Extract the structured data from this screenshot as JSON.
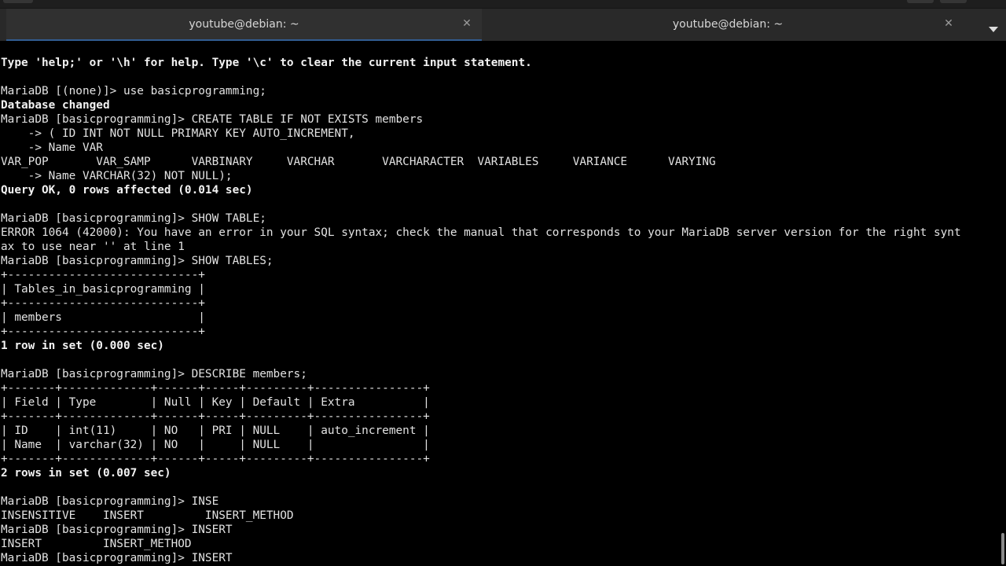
{
  "tabs": [
    {
      "title": "youtube@debian: ~",
      "active": true
    },
    {
      "title": "youtube@debian: ~",
      "active": false
    }
  ],
  "terminal": {
    "lines": [
      {
        "text": "Type 'help;' or '\\h' for help. Type '\\c' to clear the current input statement.",
        "bold": true
      },
      {
        "text": "",
        "bold": false
      },
      {
        "text": "MariaDB [(none)]> use basicprogramming;",
        "bold": false
      },
      {
        "text": "Database changed",
        "bold": true
      },
      {
        "text": "MariaDB [basicprogramming]> CREATE TABLE IF NOT EXISTS members",
        "bold": false
      },
      {
        "text": "    -> ( ID INT NOT NULL PRIMARY KEY AUTO_INCREMENT,",
        "bold": false
      },
      {
        "text": "    -> Name VAR",
        "bold": false
      },
      {
        "text": "VAR_POP       VAR_SAMP      VARBINARY     VARCHAR       VARCHARACTER  VARIABLES     VARIANCE      VARYING",
        "bold": false
      },
      {
        "text": "    -> Name VARCHAR(32) NOT NULL);",
        "bold": false
      },
      {
        "text": "Query OK, 0 rows affected (0.014 sec)",
        "bold": true
      },
      {
        "text": "",
        "bold": false
      },
      {
        "text": "MariaDB [basicprogramming]> SHOW TABLE;",
        "bold": false
      },
      {
        "text": "ERROR 1064 (42000): You have an error in your SQL syntax; check the manual that corresponds to your MariaDB server version for the right synt",
        "bold": false
      },
      {
        "text": "ax to use near '' at line 1",
        "bold": false
      },
      {
        "text": "MariaDB [basicprogramming]> SHOW TABLES;",
        "bold": false
      },
      {
        "text": "+----------------------------+",
        "bold": false
      },
      {
        "text": "| Tables_in_basicprogramming |",
        "bold": false
      },
      {
        "text": "+----------------------------+",
        "bold": false
      },
      {
        "text": "| members                    |",
        "bold": false
      },
      {
        "text": "+----------------------------+",
        "bold": false
      },
      {
        "text": "1 row in set (0.000 sec)",
        "bold": true
      },
      {
        "text": "",
        "bold": false
      },
      {
        "text": "MariaDB [basicprogramming]> DESCRIBE members;",
        "bold": false
      },
      {
        "text": "+-------+-------------+------+-----+---------+----------------+",
        "bold": false
      },
      {
        "text": "| Field | Type        | Null | Key | Default | Extra          |",
        "bold": false
      },
      {
        "text": "+-------+-------------+------+-----+---------+----------------+",
        "bold": false
      },
      {
        "text": "| ID    | int(11)     | NO   | PRI | NULL    | auto_increment |",
        "bold": false
      },
      {
        "text": "| Name  | varchar(32) | NO   |     | NULL    |                |",
        "bold": false
      },
      {
        "text": "+-------+-------------+------+-----+---------+----------------+",
        "bold": false
      },
      {
        "text": "2 rows in set (0.007 sec)",
        "bold": true
      },
      {
        "text": "",
        "bold": false
      },
      {
        "text": "MariaDB [basicprogramming]> INSE",
        "bold": false
      },
      {
        "text": "INSENSITIVE    INSERT         INSERT_METHOD",
        "bold": false
      },
      {
        "text": "MariaDB [basicprogramming]> INSERT",
        "bold": false
      },
      {
        "text": "INSERT         INSERT_METHOD",
        "bold": false
      },
      {
        "text": "MariaDB [basicprogramming]> INSERT",
        "bold": false
      }
    ]
  },
  "colors": {
    "background": "#000000",
    "foreground": "#e2e2e2",
    "tab_indicator": "#3584e4"
  },
  "icons": {
    "tab_close": "close-icon",
    "tab_menu": "chevron-down-icon"
  }
}
